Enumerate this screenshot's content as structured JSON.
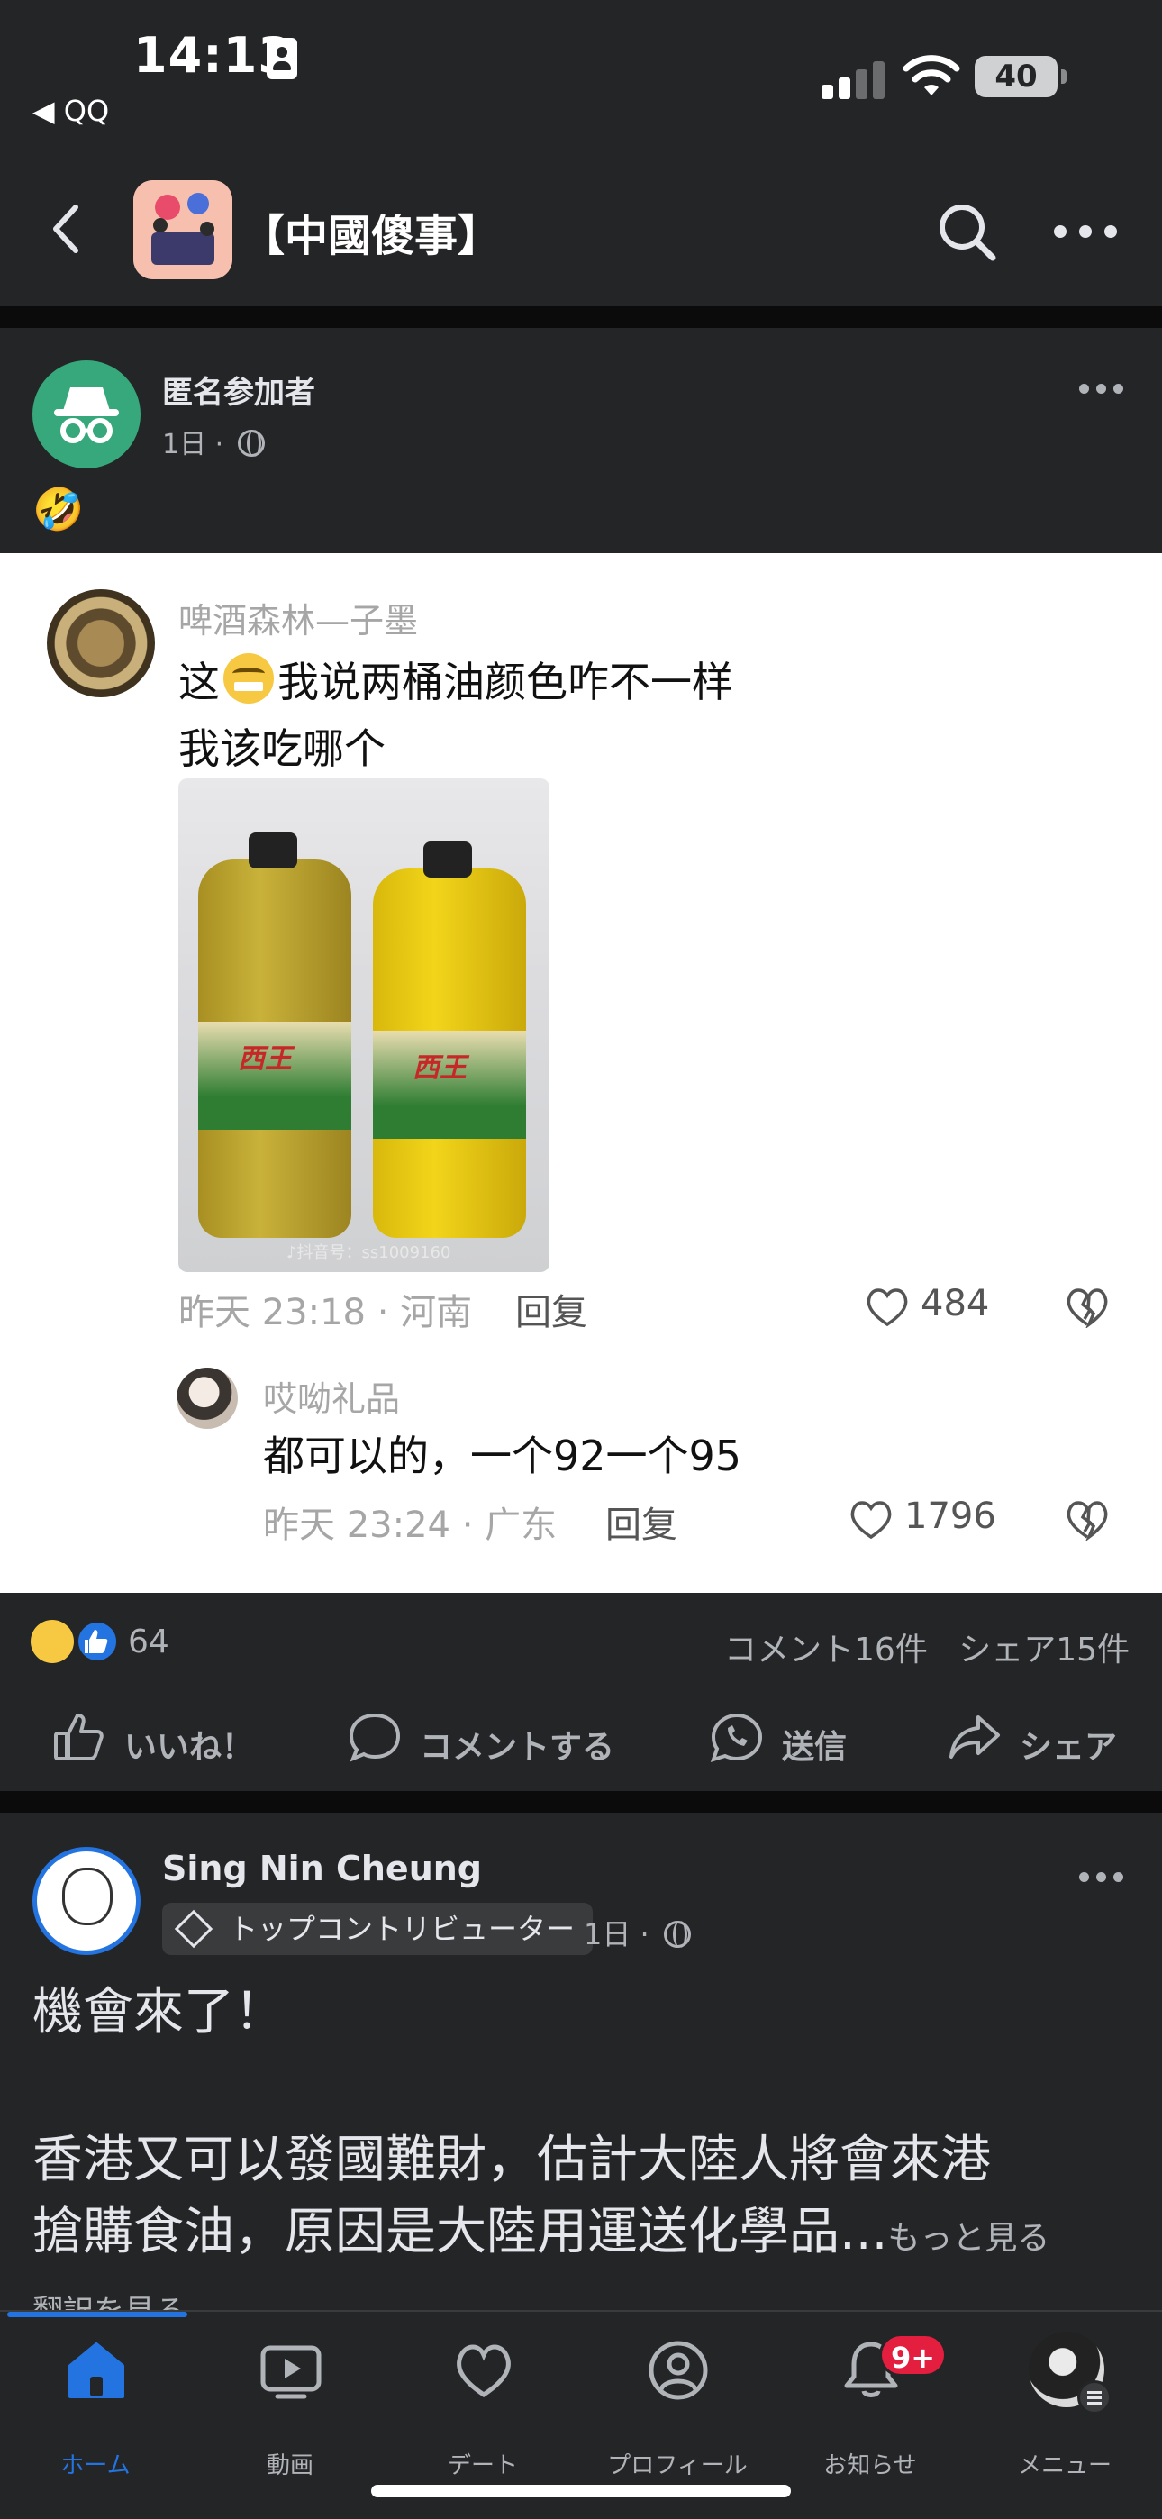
{
  "status_bar": {
    "time": "14:13",
    "back_app": "◀ QQ",
    "battery": "40"
  },
  "header": {
    "group_title": "【中國傻事】"
  },
  "post1": {
    "author": "匿名参加者",
    "meta": "1日 ·",
    "text": "🤣",
    "screenshot": {
      "comment": {
        "user": "啤酒森林—子墨",
        "text_before": "这",
        "text_after": "我说两桶油颜色咋不一样",
        "text_line2": "我该吃哪个",
        "photo_brand": "西王",
        "photo_watermark": "♪抖音号：ss1009160",
        "meta": "昨天 23:18 · 河南",
        "reply": "回复",
        "likes": "484"
      },
      "reply": {
        "user": "哎呦礼品",
        "text": "都可以的，一个92一个95",
        "meta": "昨天 23:24 · 广东",
        "reply": "回复",
        "likes": "1796"
      }
    },
    "reactions_count": "64",
    "comments": "コメント16件",
    "shares": "シェア15件",
    "actions": {
      "like": "いいね！",
      "comment": "コメントする",
      "send": "送信",
      "share": "シェア"
    }
  },
  "post2": {
    "author": "Sing Nin Cheung",
    "badge": "トップコントリビューター",
    "meta": "1日 ·",
    "line1": "機會來了！",
    "line2": "香港又可以發國難財，估計大陸人將會來港",
    "line3": "搶購食油，原因是大陸用運送化學品...",
    "see_more": "もっと見る",
    "translate": "翻訳を見る"
  },
  "tabbar": {
    "home": "ホーム",
    "video": "動画",
    "dating": "デート",
    "profile": "プロフィール",
    "notifications": "お知らせ",
    "notifications_badge": "9+",
    "menu": "メニュー"
  },
  "colors": {
    "background": "#242526",
    "accent": "#2374e1",
    "badge_red": "#e41e3f",
    "anon_green": "#36a87c"
  },
  "icons": [
    "id-card-icon",
    "signal-icon",
    "wifi-icon",
    "battery-icon",
    "back-chevron-icon",
    "search-icon",
    "more-icon",
    "incognito-icon",
    "globe-icon",
    "heart-icon",
    "broken-heart-icon",
    "haha-reaction-icon",
    "like-reaction-icon",
    "thumbs-up-icon",
    "comment-bubble-icon",
    "whatsapp-icon",
    "share-arrow-icon",
    "top-contributor-icon",
    "home-icon",
    "video-icon",
    "dating-heart-icon",
    "profile-icon",
    "bell-icon",
    "menu-icon"
  ]
}
